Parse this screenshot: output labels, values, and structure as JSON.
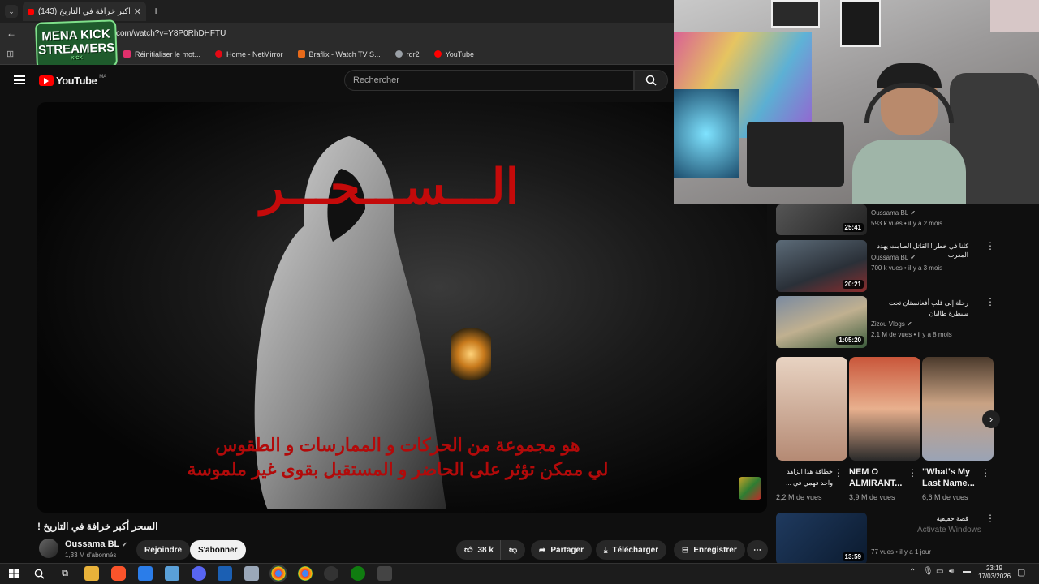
{
  "browser": {
    "tab_title": "(143) السحر أكبر خرافة في التاريخ",
    "url": "com/watch?v=Y8P0RhDHFTU",
    "bookmarks": [
      {
        "label": "Réinitialiser le mot...",
        "color": "#e1306c"
      },
      {
        "label": "Home - NetMirror",
        "color": "#e50914"
      },
      {
        "label": "Braflix - Watch TV S...",
        "color": "#e86a1a"
      },
      {
        "label": "rdr2",
        "color": "#9aa0a6"
      },
      {
        "label": "YouTube",
        "color": "#ff0000"
      }
    ]
  },
  "overlay": {
    "logo_line1": "MENA KICK",
    "logo_line2": "STREAMERS",
    "logo_small": "KICK"
  },
  "youtube": {
    "brand": "YouTube",
    "region": "MA",
    "search_placeholder": "Rechercher"
  },
  "video": {
    "title_overlay": "الـــســـحـــر",
    "sub_line1": "هو مجموعة من الحركات و الممارسات و الطقوس",
    "sub_line2": "لي ممكن تؤثر على الحاضر و المستقبل بقوى غير ملموسة",
    "page_title": "السحر أكبر خرافة في التاريخ !",
    "channel": "Oussama BL",
    "subscribers": "1,33 M d'abonnés",
    "join_label": "Rejoindre",
    "subscribe_label": "S'abonner",
    "likes": "38 k",
    "share_label": "Partager",
    "download_label": "Télécharger",
    "save_label": "Enregistrer"
  },
  "sidebar": {
    "items": [
      {
        "title": "",
        "channel": "Oussama BL",
        "meta": "593 k vues • il y a 2 mois",
        "duration": "25:41"
      },
      {
        "title": "كلنا في خطر ! القاتل الصامت يهدد المغرب",
        "channel": "Oussama BL",
        "meta": "700 k vues • il y a 3 mois",
        "duration": "20:21"
      },
      {
        "title": "رحلة إلى قلب أفغانستان تحت سيطرة طالبان",
        "channel": "Zizou Vlogs",
        "meta": "2,1 M de vues • il y a 8 mois",
        "duration": "1:05:20"
      },
      {
        "title": "قصة حقيقية",
        "channel": "",
        "meta": "77 vues • il y a 1 jour",
        "duration": "13:59"
      }
    ],
    "shorts": [
      {
        "title": "خطافة هذا الزاهد واحد فهمي في ...",
        "views": "2,2 M de vues"
      },
      {
        "title": "NEM O ALMIRANT...",
        "views": "3,9 M de vues"
      },
      {
        "title": "\"What's My Last Name...",
        "views": "6,6 M de vues"
      }
    ],
    "activate_windows": "Activate Windows"
  },
  "taskbar": {
    "time": "23:19",
    "date": "17/03/2026"
  }
}
